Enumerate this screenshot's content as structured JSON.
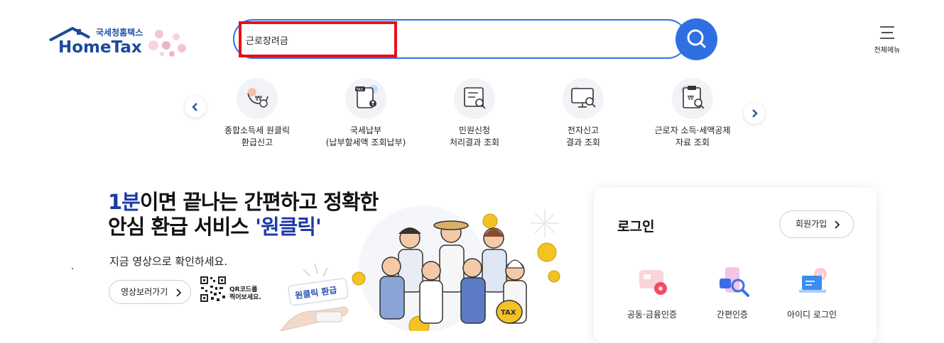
{
  "header": {
    "logo_korean": "국세청홈택스",
    "logo_english": "HomeTax",
    "menu_label": "전체메뉴"
  },
  "search": {
    "value": "근로장려금",
    "placeholder": ""
  },
  "quick_menu": {
    "items": [
      {
        "line1": "종합소득세 원클릭",
        "line2": "환급신고",
        "icon": "refund-coin-icon"
      },
      {
        "line1": "국세납부",
        "line2": "(납부할세액 조회납부)",
        "icon": "tax-payment-icon"
      },
      {
        "line1": "민원신청",
        "line2": "처리결과 조회",
        "icon": "document-search-icon"
      },
      {
        "line1": "전자신고",
        "line2": "결과 조회",
        "icon": "monitor-search-icon"
      },
      {
        "line1": "근로자 소득·세액공제",
        "line2": "자료 조회",
        "icon": "clipboard-search-icon"
      }
    ]
  },
  "banner": {
    "headline_blue": "1분",
    "headline_rest1": "이면 끝나는 간편하고 정확한",
    "headline_line2_pre": "안심 환급 서비스 ",
    "headline_line2_blue": "'원클릭'",
    "subline": "지금 영상으로 확인하세요.",
    "video_button": "영상보러가기",
    "qr_caption_1": "QR코드를",
    "qr_caption_2": "찍어보세요.",
    "sign_text": "원클릭 환급",
    "tax_bag_text": "TAX"
  },
  "login": {
    "title": "로그인",
    "join_button": "회원가입",
    "options": [
      {
        "label": "공동·금융인증",
        "icon": "certificate-card-icon"
      },
      {
        "label": "간편인증",
        "icon": "phone-search-icon"
      },
      {
        "label": "아이디 로그인",
        "icon": "laptop-login-icon"
      }
    ]
  },
  "colors": {
    "primary_blue": "#2f6fe2",
    "highlight_red": "#e8101a",
    "logo_blue": "#1b4a9c"
  }
}
